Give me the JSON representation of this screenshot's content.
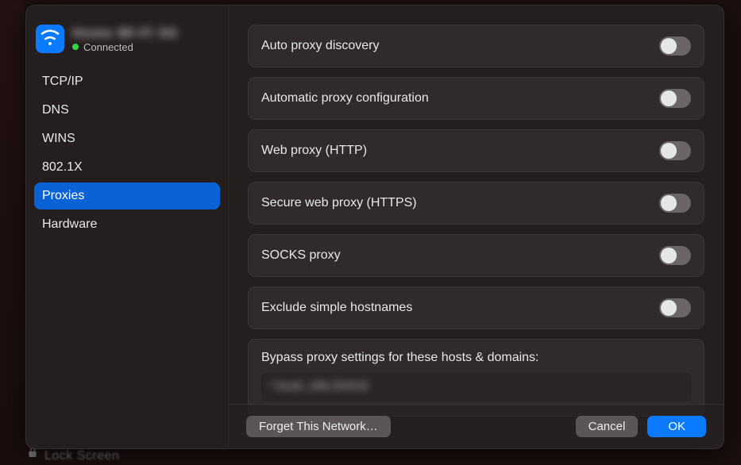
{
  "sidebar": {
    "network_name": "Home Wi-Fi 5G",
    "status_label": "Connected",
    "items": [
      {
        "label": "TCP/IP"
      },
      {
        "label": "DNS"
      },
      {
        "label": "WINS"
      },
      {
        "label": "802.1X"
      },
      {
        "label": "Proxies"
      },
      {
        "label": "Hardware"
      }
    ],
    "selected_index": 4
  },
  "proxies": {
    "rows": [
      {
        "label": "Auto proxy discovery",
        "on": false
      },
      {
        "label": "Automatic proxy configuration",
        "on": false
      },
      {
        "label": "Web proxy (HTTP)",
        "on": false
      },
      {
        "label": "Secure web proxy (HTTPS)",
        "on": false
      },
      {
        "label": "SOCKS proxy",
        "on": false
      },
      {
        "label": "Exclude simple hostnames",
        "on": false
      }
    ],
    "bypass_label": "Bypass proxy settings for these hosts & domains:",
    "bypass_value": "*.local, 169.254/16"
  },
  "footer": {
    "forget_label": "Forget This Network…",
    "cancel_label": "Cancel",
    "ok_label": "OK"
  },
  "background": {
    "lock_screen_label": "Lock Screen"
  }
}
